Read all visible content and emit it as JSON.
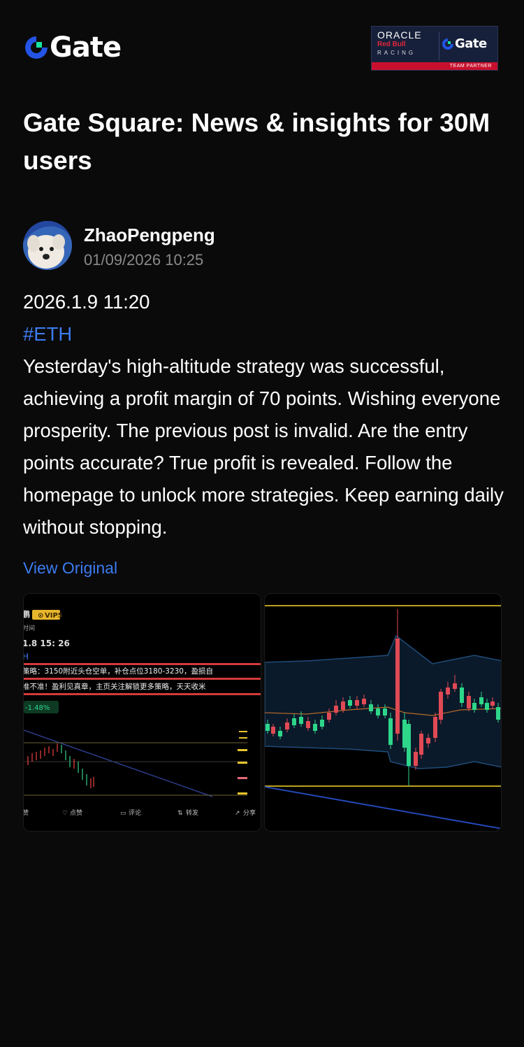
{
  "brand": {
    "logo_text": "Gate",
    "logo_icon": "gate-logo-icon",
    "accent": "#2354e6",
    "accent_green": "#17e5a1"
  },
  "partner": {
    "oracle": "ORACLE",
    "redbull": "Red Bull",
    "racing": "RACING",
    "gate": "Gate",
    "strip": "TEAM PARTNER",
    "strip_color": "#c8102e"
  },
  "page": {
    "title": "Gate Square: News & insights for 30M users"
  },
  "author": {
    "name": "ZhaoPengpeng",
    "timestamp": "01/09/2026 10:25"
  },
  "post": {
    "date_line": "2026.1.9 11:20",
    "hashtag": "#ETH",
    "body": "Yesterday's high-altitude strategy was successful, achieving a profit margin of 70 points. Wishing everyone prosperity. The previous post is invalid. Are the entry points accurate? True profit is revealed. Follow the homepage to unlock more strategies. Keep earning daily without stopping.",
    "view_original": "View Original",
    "link_color": "#3d7bf0"
  },
  "images": {
    "left": {
      "badge": "VIP5",
      "time_line": "1.8 15: 26",
      "strategy_line_1": "策略：3150附近头仓空单，补仓点位3180-3230，盈损自",
      "strategy_line_2": "准不准！盈利见真章，主页关注解锁更多策略，天天收米",
      "change": "-1.48%",
      "actions": [
        "赞",
        "点赞",
        "评论",
        "转发",
        "分享"
      ]
    },
    "right": {}
  }
}
